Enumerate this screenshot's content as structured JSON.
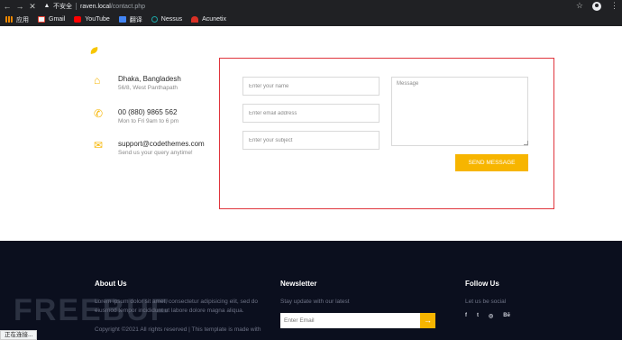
{
  "browser": {
    "security_label": "不安全",
    "url_host": "raven.local",
    "url_path": "/contact.php",
    "bookmarks": [
      {
        "label": "应用",
        "icon": "apps-icon"
      },
      {
        "label": "Gmail",
        "icon": "gmail-icon"
      },
      {
        "label": "YouTube",
        "icon": "youtube-icon"
      },
      {
        "label": "翻译",
        "icon": "translate-icon"
      },
      {
        "label": "Nessus",
        "icon": "nessus-icon"
      },
      {
        "label": "Acunetix",
        "icon": "acunetix-icon"
      }
    ],
    "status_text": "正在连接..."
  },
  "contact": {
    "address": {
      "main": "Dhaka, Bangladesh",
      "sub": "56/8, West Panthapath"
    },
    "phone": {
      "main": "00 (880) 9865 562",
      "sub": "Mon to Fri 9am to 6 pm"
    },
    "email": {
      "main": "support@codethemes.com",
      "sub": "Send us your query anytime!"
    }
  },
  "form": {
    "name_placeholder": "Enter your name",
    "email_placeholder": "Enter email address",
    "subject_placeholder": "Enter your subject",
    "message_placeholder": "Message",
    "send_label": "SEND MESSAGE"
  },
  "footer": {
    "about": {
      "heading": "About Us",
      "text1": "Lorem ipsum dolor sit amet, consectetur adipisicing elit, sed do",
      "text2": "eiusmod tempor incididunt ut labore dolore magna aliqua.",
      "copyright": "Copyright ©2021 All rights reserved | This template is made with"
    },
    "newsletter": {
      "heading": "Newsletter",
      "text": "Stay update with our latest",
      "placeholder": "Enter Email",
      "submit_icon": "→"
    },
    "follow": {
      "heading": "Follow Us",
      "text": "Let us be social",
      "icons": [
        "f",
        "t",
        "◎",
        "Bē"
      ]
    }
  },
  "colors": {
    "accent": "#f7b500",
    "form_border": "#e0353d",
    "footer_bg": "#0b0f1e"
  }
}
